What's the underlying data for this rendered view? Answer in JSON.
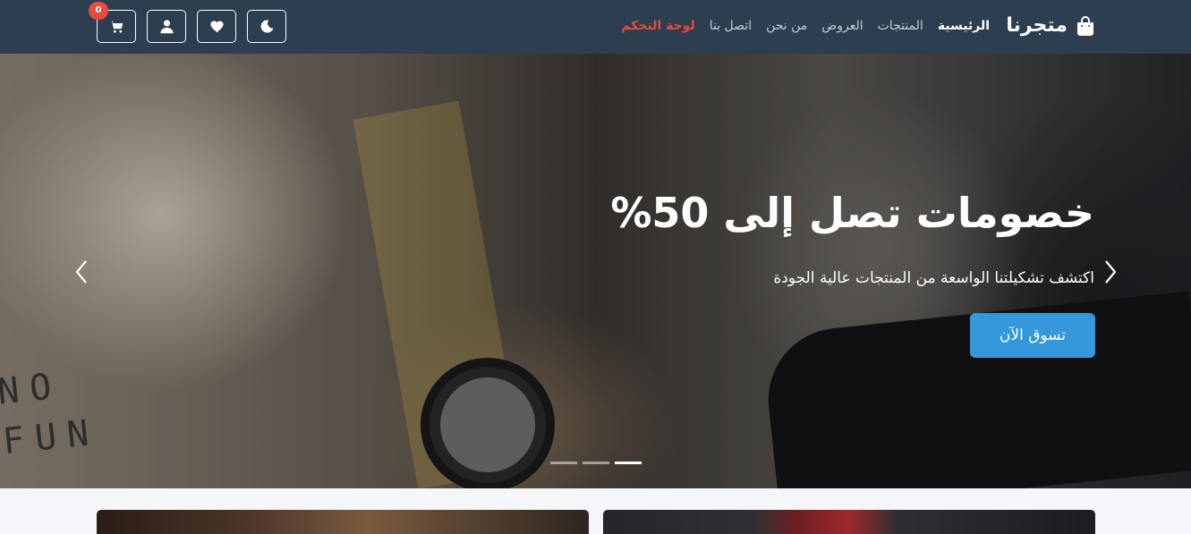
{
  "brand": {
    "name": "متجرنا",
    "icon": "shopping-bag-icon"
  },
  "nav": {
    "links": [
      {
        "label": "الرئيسية",
        "active": true
      },
      {
        "label": "المنتجات",
        "active": false
      },
      {
        "label": "العروض",
        "active": false
      },
      {
        "label": "من نحن",
        "active": false
      },
      {
        "label": "اتصل بنا",
        "active": false
      },
      {
        "label": "لوحة التحكم",
        "active": false,
        "highlight": "#e74c3c"
      }
    ]
  },
  "actions": {
    "theme_icon": "moon-icon",
    "wishlist_icon": "heart-icon",
    "account_icon": "user-icon",
    "cart_icon": "cart-icon",
    "cart_count": "0"
  },
  "hero": {
    "title": "خصومات تصل إلى 50%",
    "subtitle": "اكتشف تشكيلتنا الواسعة من المنتجات عالية الجودة",
    "cta_label": "تسوق الآن",
    "shirt_text_line1": "NO",
    "shirt_text_line2": "FUN",
    "indicators": 3,
    "active_indicator": 3
  },
  "colors": {
    "navbar": "#2c3e50",
    "accent": "#3498db",
    "danger": "#e74c3c"
  }
}
